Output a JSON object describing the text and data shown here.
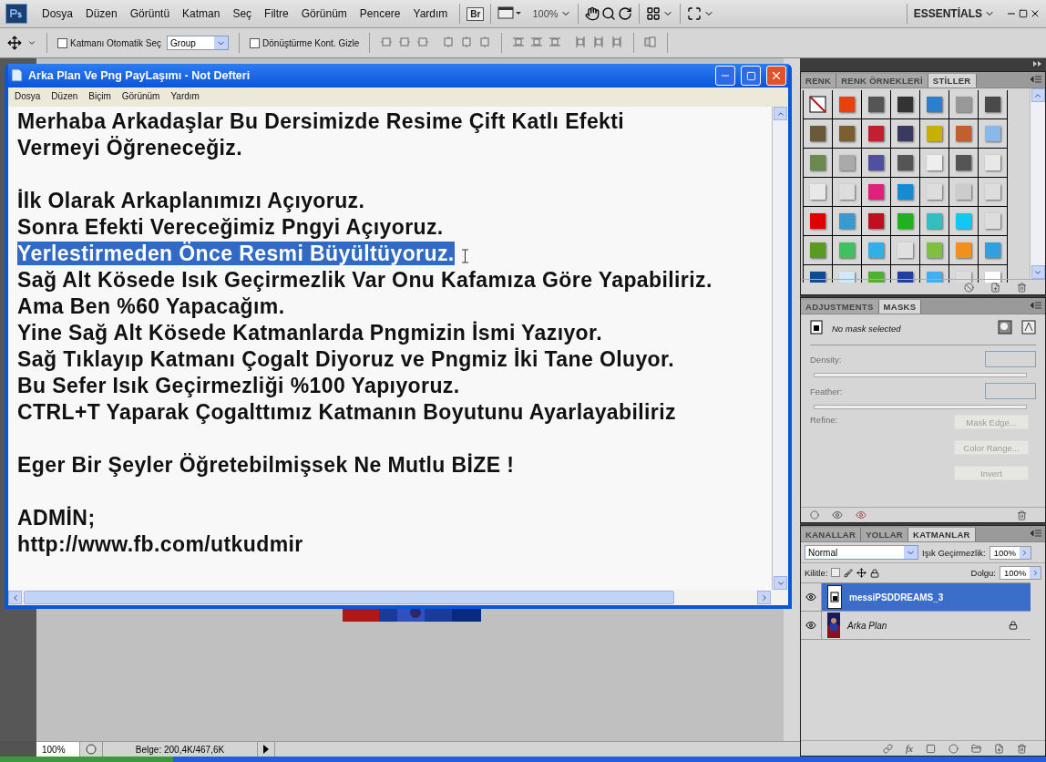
{
  "menu_bar": {
    "items": [
      "Dosya",
      "Düzen",
      "Görüntü",
      "Katman",
      "Seç",
      "Filtre",
      "Görünüm",
      "Pencere",
      "Yardım"
    ],
    "bridge_button": "Br",
    "zoom": "100%",
    "workspace": "ESSENTİALS"
  },
  "options_bar": {
    "auto_select": {
      "label": "Katmanı Otomatik Seç",
      "checked": false
    },
    "auto_select_target": "Group",
    "transform_controls": {
      "label": "Dönüştürme Kont. Gizle",
      "checked": false
    }
  },
  "notepad": {
    "title": "Arka Plan Ve Png PayLaşımı - Not Defteri",
    "menu": [
      "Dosya",
      "Düzen",
      "Biçim",
      "Görünüm",
      "Yardım"
    ],
    "paragraphs": [
      [
        {
          "text": "Merhaba Arkadaşlar Bu Dersimizde Resime Çift Katlı Efekti",
          "selected": false
        },
        {
          "text": "Vermeyi Öğreneceğiz.",
          "selected": false
        }
      ],
      [
        {
          "text": "İlk Olarak Arkaplanımızı Açıyoruz.",
          "selected": false
        },
        {
          "text": "Sonra Efekti Vereceğimiz Pngyi Açıyoruz.",
          "selected": false
        },
        {
          "text": "Yerlestirmeden Önce Resmi Büyültüyoruz.",
          "selected": true
        },
        {
          "text": "Sağ Alt Kösede Isık Geçirmezlik Var Onu Kafamıza Göre Yapabiliriz.",
          "selected": false
        },
        {
          "text": "Ama Ben %60 Yapacağım.",
          "selected": false
        },
        {
          "text": "Yine Sağ Alt Kösede Katmanlarda Pngmizin İsmi Yazıyor.",
          "selected": false
        },
        {
          "text": "Sağ Tıklayıp Katmanı Çogalt Diyoruz ve Pngmiz İki Tane Oluyor.",
          "selected": false
        },
        {
          "text": "Bu Sefer Isık Geçirmezliği %100 Yapıyoruz.",
          "selected": false
        },
        {
          "text": "CTRL+T Yaparak Çogalttımız Katmanın Boyutunu Ayarlayabiliriz",
          "selected": false
        }
      ],
      [
        {
          "text": "Eger Bir Şeyler Öğretebilmişsek Ne Mutlu BİZE !",
          "selected": false
        }
      ],
      [
        {
          "text": "ADMİN;",
          "selected": false
        },
        {
          "text": "http://www.fb.com/utkudmir",
          "selected": false
        }
      ]
    ]
  },
  "styles_panel": {
    "tabs": [
      {
        "label": "RENK",
        "selected": false
      },
      {
        "label": "RENK ÖRNEKLERİ",
        "selected": false
      },
      {
        "label": "STİLLER",
        "selected": true
      }
    ]
  },
  "masks_panel": {
    "tabs": [
      {
        "label": "ADJUSTMENTS",
        "selected": false
      },
      {
        "label": "MASKS",
        "selected": true
      }
    ],
    "status": "No mask selected",
    "disabled": true,
    "density_label": "Density:",
    "feather_label": "Feather:",
    "refine_label": "Refine:",
    "buttons": [
      "Mask Edge...",
      "Color Range...",
      "Invert"
    ]
  },
  "layers_panel": {
    "tabs": [
      {
        "label": "KANALLAR",
        "selected": false
      },
      {
        "label": "YOLLAR",
        "selected": false
      },
      {
        "label": "KATMANLAR",
        "selected": true
      }
    ],
    "blend_mode": "Normal",
    "opacity_label": "Işık Geçirmezlik:",
    "opacity": "100%",
    "lock_label": "Kilitle:",
    "fill_label": "Dolgu:",
    "fill": "100%",
    "effects_button": "fx",
    "layers": [
      {
        "name": "messiPSDDREAMS_3",
        "kind": "smart",
        "selected": true,
        "visible": true,
        "locked": false
      },
      {
        "name": "Arka Plan",
        "kind": "background",
        "selected": false,
        "visible": true,
        "locked": true
      }
    ]
  },
  "status_bar": {
    "zoom": "100%",
    "document": "Belge: 200,4K/467,6K"
  }
}
